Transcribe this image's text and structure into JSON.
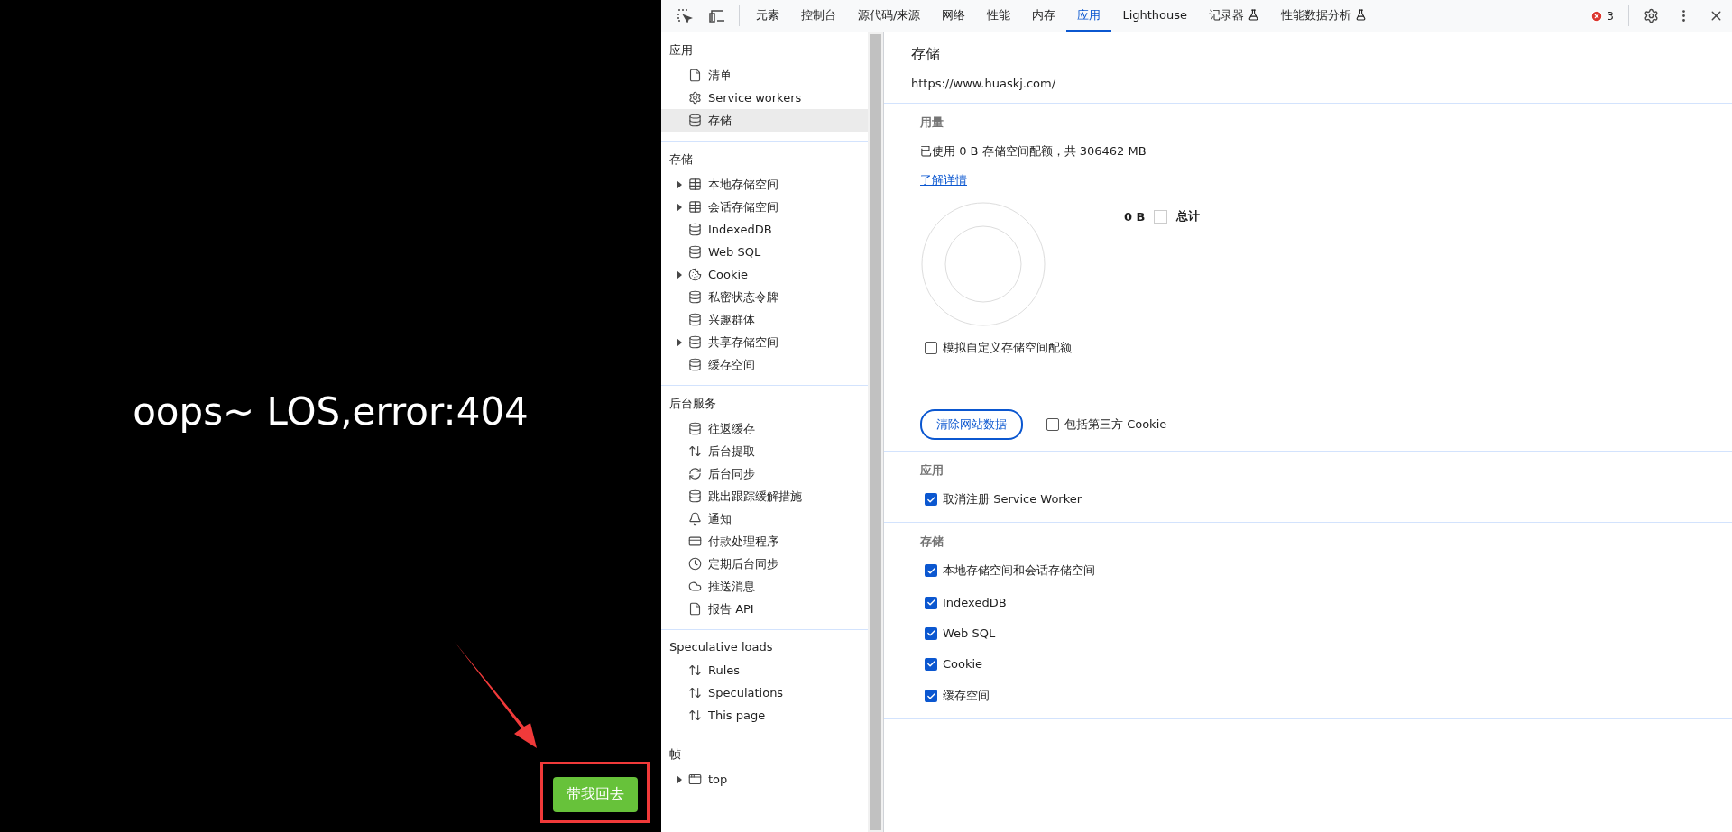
{
  "page": {
    "message": "oops~ LOS,error:404",
    "back_button": "带我回去"
  },
  "devtools": {
    "toolbar": {
      "tabs": [
        {
          "label": "元素",
          "selected": false,
          "experimental": false
        },
        {
          "label": "控制台",
          "selected": false,
          "experimental": false
        },
        {
          "label": "源代码/来源",
          "selected": false,
          "experimental": false
        },
        {
          "label": "网络",
          "selected": false,
          "experimental": false
        },
        {
          "label": "性能",
          "selected": false,
          "experimental": false
        },
        {
          "label": "内存",
          "selected": false,
          "experimental": false
        },
        {
          "label": "应用",
          "selected": true,
          "experimental": false
        },
        {
          "label": "Lighthouse",
          "selected": false,
          "experimental": false
        },
        {
          "label": "记录器",
          "selected": false,
          "experimental": true
        },
        {
          "label": "性能数据分析",
          "selected": false,
          "experimental": true
        }
      ],
      "error_count": "3"
    },
    "sidebar": {
      "sections": [
        {
          "title": "应用",
          "items": [
            {
              "label": "清单",
              "kind": "file",
              "selected": false
            },
            {
              "label": "Service workers",
              "kind": "gears",
              "selected": false
            },
            {
              "label": "存储",
              "kind": "database",
              "selected": true
            }
          ]
        },
        {
          "title": "存储",
          "items": [
            {
              "label": "本地存储空间",
              "kind": "table",
              "selected": false,
              "expanded": false
            },
            {
              "label": "会话存储空间",
              "kind": "table",
              "selected": false,
              "expanded": false
            },
            {
              "label": "IndexedDB",
              "kind": "database",
              "selected": false
            },
            {
              "label": "Web SQL",
              "kind": "database",
              "selected": false
            },
            {
              "label": "Cookie",
              "kind": "cookie",
              "selected": false,
              "expanded": false
            },
            {
              "label": "私密状态令牌",
              "kind": "database",
              "selected": false
            },
            {
              "label": "兴趣群体",
              "kind": "database",
              "selected": false
            },
            {
              "label": "共享存储空间",
              "kind": "database",
              "selected": false,
              "expanded": false
            },
            {
              "label": "缓存空间",
              "kind": "database",
              "selected": false
            }
          ]
        },
        {
          "title": "后台服务",
          "items": [
            {
              "label": "往返缓存",
              "kind": "database",
              "selected": false
            },
            {
              "label": "后台提取",
              "kind": "updown",
              "selected": false
            },
            {
              "label": "后台同步",
              "kind": "sync",
              "selected": false
            },
            {
              "label": "跳出跟踪缓解措施",
              "kind": "database",
              "selected": false
            },
            {
              "label": "通知",
              "kind": "bell",
              "selected": false
            },
            {
              "label": "付款处理程序",
              "kind": "card",
              "selected": false
            },
            {
              "label": "定期后台同步",
              "kind": "clock",
              "selected": false
            },
            {
              "label": "推送消息",
              "kind": "cloud",
              "selected": false
            },
            {
              "label": "报告 API",
              "kind": "file",
              "selected": false
            }
          ]
        },
        {
          "title": "Speculative loads",
          "items": [
            {
              "label": "Rules",
              "kind": "updown",
              "selected": false
            },
            {
              "label": "Speculations",
              "kind": "updown",
              "selected": false
            },
            {
              "label": "This page",
              "kind": "updown",
              "selected": false
            }
          ]
        },
        {
          "title": "帧",
          "items": [
            {
              "label": "top",
              "kind": "frame",
              "selected": false,
              "expanded": false
            }
          ]
        }
      ]
    },
    "main": {
      "title": "存储",
      "origin": "https://www.huaskj.com/",
      "usage": {
        "heading": "用量",
        "text": "已使用 0 B 存储空间配额，共 306462 MB",
        "link": "了解详情",
        "legend_value": "0 B",
        "legend_label": "总计",
        "emulate": {
          "label": "模拟自定义存储空间配额",
          "checked": false
        }
      },
      "clear_button": "清除网站数据",
      "third_party": {
        "label": "包括第三方 Cookie",
        "checked": false
      },
      "groups": [
        {
          "heading": "应用",
          "options": [
            {
              "label": "取消注册 Service Worker",
              "checked": true
            }
          ]
        },
        {
          "heading": "存储",
          "options": [
            {
              "label": "本地存储空间和会话存储空间",
              "checked": true
            },
            {
              "label": "IndexedDB",
              "checked": true
            },
            {
              "label": "Web SQL",
              "checked": true
            },
            {
              "label": "Cookie",
              "checked": true
            },
            {
              "label": "缓存空间",
              "checked": true
            }
          ]
        }
      ]
    }
  }
}
